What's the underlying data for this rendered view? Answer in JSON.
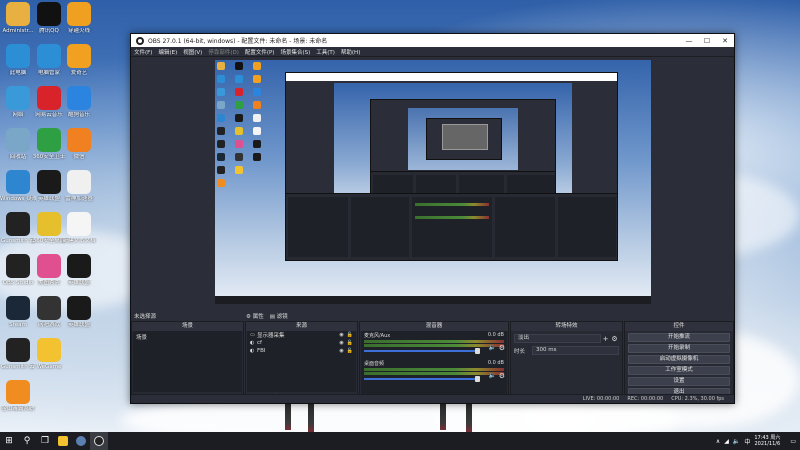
{
  "desktop": {
    "icons_col1": [
      {
        "label": "Administr...",
        "icon": "user-folder-icon",
        "color": "#e8b040"
      },
      {
        "label": "此电脑",
        "icon": "computer-icon",
        "color": "#2c8fd6"
      },
      {
        "label": "网络",
        "icon": "network-icon",
        "color": "#3a9ad9"
      },
      {
        "label": "回收站",
        "icon": "recycle-bin-icon",
        "color": "#7aa6c8"
      },
      {
        "label": "Windows 疑难解答",
        "icon": "troubleshoot-icon",
        "color": "#2f86d0"
      },
      {
        "label": "Gunsmith 云",
        "icon": "g-app-icon",
        "color": "#222"
      },
      {
        "label": "OBS Studio",
        "icon": "obs-icon",
        "color": "#222"
      },
      {
        "label": "Steam",
        "icon": "steam-icon",
        "color": "#1b2838"
      },
      {
        "label": "Gunsmith 云",
        "icon": "g-app-gold-icon",
        "color": "#222"
      },
      {
        "label": "金山毒霸系统",
        "icon": "duba-icon",
        "color": "#f08c20"
      }
    ],
    "icons_col2": [
      {
        "label": "腾讯QQ",
        "icon": "qq-icon",
        "color": "#111"
      },
      {
        "label": "电脑管家",
        "icon": "power-icon",
        "color": "#2c8fd6"
      },
      {
        "label": "网易云音乐",
        "icon": "netease-music-icon",
        "color": "#d8232a"
      },
      {
        "label": "360安全卫士",
        "icon": "security-shield-icon",
        "color": "#2ea043"
      },
      {
        "label": "英雄联盟",
        "icon": "lol-icon",
        "color": "#1a1a1a"
      },
      {
        "label": "360安全桌面",
        "icon": "plus-icon",
        "color": "#e6c02c"
      },
      {
        "label": "美图秀秀",
        "icon": "color-wheel-icon",
        "color": "#e05090"
      },
      {
        "label": "网吧游戏",
        "icon": "gamepad-icon",
        "color": "#333"
      },
      {
        "label": "WeGame",
        "icon": "owl-icon",
        "color": "#f2c230"
      }
    ],
    "icons_col3": [
      {
        "label": "穿越火线",
        "icon": "cf-icon",
        "color": "#f0a020"
      },
      {
        "label": "爱奇艺",
        "icon": "iqiyi-icon",
        "color": "#f2a020"
      },
      {
        "label": "酷狗音乐",
        "icon": "kugou-icon",
        "color": "#2a84e0"
      },
      {
        "label": "微信",
        "icon": "wechat-icon",
        "color": "#f08020"
      },
      {
        "label": "雷神加速器",
        "icon": "lightning-icon",
        "color": "#f0f0f0"
      },
      {
        "label": "新建文本文档",
        "icon": "text-file-icon",
        "color": "#f5f5f5"
      },
      {
        "label": "英雄联盟",
        "icon": "lol-icon",
        "color": "#1a1a1a"
      },
      {
        "label": "英雄联盟",
        "icon": "lol-icon",
        "color": "#1a1a1a"
      }
    ]
  },
  "obs": {
    "title": "OBS 27.0.1 (64-bit, windows) - 配置文件: 未命名 - 场景: 未命名",
    "menu": [
      "文件(F)",
      "编辑(E)",
      "视图(V)",
      "停靠部件(D)",
      "配置文件(P)",
      "场景集合(S)",
      "工具(T)",
      "帮助(H)"
    ],
    "toolbar_label": "未选择源",
    "props_label": "属性",
    "filters_label": "滤镜",
    "docks": {
      "scenes": {
        "title": "场景",
        "items": [
          "场景"
        ]
      },
      "sources": {
        "title": "来源",
        "items": [
          {
            "name": "显示器采集",
            "icon": "monitor-icon"
          },
          {
            "name": "cf",
            "icon": "game-capture-icon"
          },
          {
            "name": "FBI",
            "icon": "game-capture-icon"
          }
        ]
      },
      "mixer": {
        "title": "混音器",
        "channels": [
          {
            "name": "麦克风/Aux",
            "db": "0.0 dB"
          },
          {
            "name": "桌面音频",
            "db": "0.0 dB"
          }
        ]
      },
      "transitions": {
        "title": "转场特效",
        "type": "淡出",
        "duration_label": "时长",
        "duration": "300 ms"
      },
      "controls": {
        "title": "控件",
        "buttons": [
          "开始推流",
          "开始录制",
          "启动虚拟摄像机",
          "工作室模式",
          "设置",
          "退出"
        ]
      }
    },
    "footer_symbols": {
      "add": "+",
      "remove": "−",
      "up": "∧",
      "down": "∨",
      "gear": "⚙"
    },
    "status": {
      "live": "LIVE: 00:00:00",
      "rec": "REC: 00:00:00",
      "cpu": "CPU: 2.3%, 30.00 fps"
    }
  },
  "taskbar": {
    "start_icon": "windows-start-icon",
    "time": "17:43 周六",
    "date": "2021/11/6",
    "tray_lang": "中"
  }
}
